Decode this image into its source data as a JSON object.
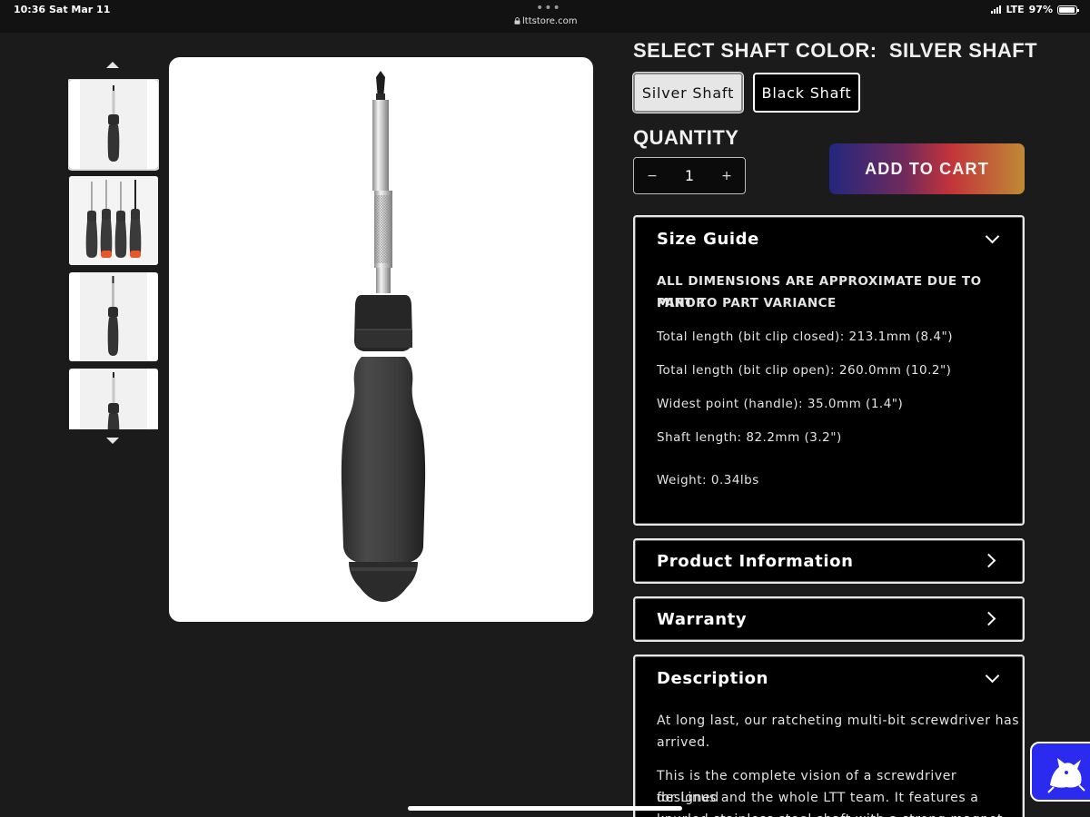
{
  "status_bar": {
    "time": "10:36",
    "date": "Sat Mar 11",
    "url": "lttstore.com",
    "network": "LTE",
    "battery": "97%",
    "battery_level": 0.97
  },
  "gallery": {
    "thumbnails": [
      {
        "icon": "single-screwdriver-thumbnail"
      },
      {
        "icon": "four-screwdrivers-thumbnail"
      },
      {
        "icon": "screwdriver-side-thumbnail"
      },
      {
        "icon": "screwdriver-back-thumbnail"
      }
    ],
    "main_image_icon": "ratcheting-screwdriver-image"
  },
  "shaft_color": {
    "label": "SELECT SHAFT COLOR:",
    "selected": "SILVER SHAFT",
    "options": [
      "Silver Shaft",
      "Black Shaft"
    ]
  },
  "quantity": {
    "label": "QUANTITY",
    "value": "1",
    "decrement": "−",
    "increment": "+"
  },
  "cart": {
    "add_label": "ADD TO CART"
  },
  "size_guide": {
    "title": "Size Guide",
    "note_line1": "ALL DIMENSIONS ARE APPROXIMATE DUE TO MINOR",
    "note_line2": "PART TO PART VARIANCE",
    "rows": [
      "Total length (bit clip closed): 213.1mm (8.4\")",
      "Total length (bit clip open): 260.0mm (10.2\")",
      "Widest point (handle): 35.0mm (1.4\")",
      "Shaft length: 82.2mm (3.2\")",
      "Weight: 0.34lbs"
    ]
  },
  "product_info": {
    "title": "Product Information"
  },
  "warranty": {
    "title": "Warranty"
  },
  "description": {
    "title": "Description",
    "p1_line1": "At long last, our ratcheting multi-bit screwdriver has",
    "p1_line2": "arrived.",
    "p2_line1": "This is the complete vision of a screwdriver designed",
    "p2_line2": "for Linus and the whole LTT team. It features a",
    "p2_line3": "knurled stainless steel shaft with a strong magnet"
  },
  "colors": {
    "background": "#1b1b1b",
    "panel": "#000000",
    "chat_widget": "#2b2bf0"
  }
}
